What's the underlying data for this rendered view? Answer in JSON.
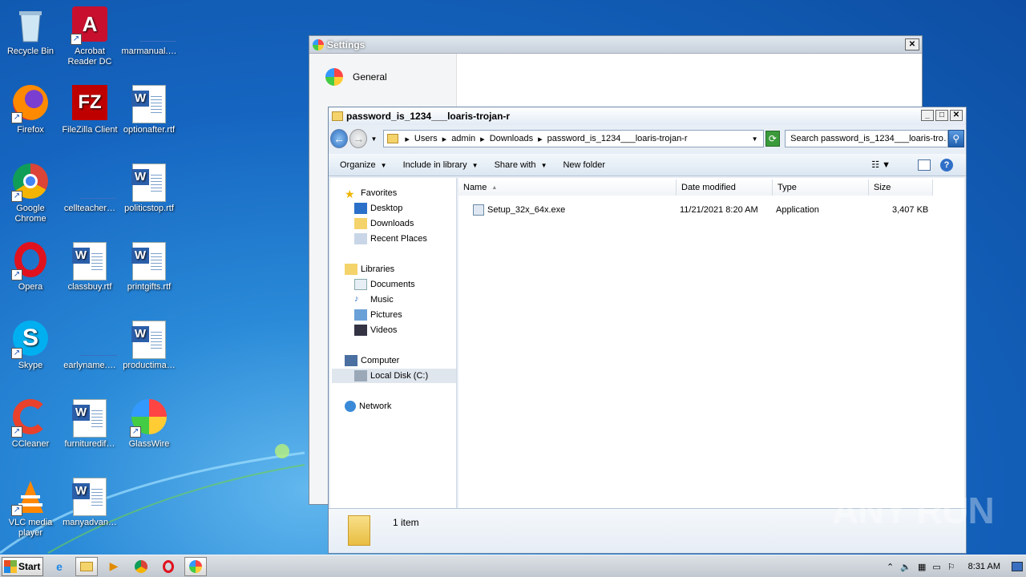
{
  "desktop": {
    "icons": [
      {
        "label": "Recycle Bin",
        "icon": "recycle-bin-icon"
      },
      {
        "label": "Acrobat Reader DC",
        "icon": "acrobat-icon"
      },
      {
        "label": "marmanual.…",
        "icon": "word-doc-icon"
      },
      {
        "label": "Firefox",
        "icon": "firefox-icon"
      },
      {
        "label": "FileZilla Client",
        "icon": "filezilla-icon"
      },
      {
        "label": "optionafter.rtf",
        "icon": "word-doc-icon"
      },
      {
        "label": "Google Chrome",
        "icon": "chrome-icon"
      },
      {
        "label": "cellteacher…",
        "icon": "word-doc-icon"
      },
      {
        "label": "politicstop.rtf",
        "icon": "word-doc-icon"
      },
      {
        "label": "Opera",
        "icon": "opera-icon"
      },
      {
        "label": "classbuy.rtf",
        "icon": "word-doc-icon"
      },
      {
        "label": "printgifts.rtf",
        "icon": "word-doc-icon"
      },
      {
        "label": "Skype",
        "icon": "skype-icon"
      },
      {
        "label": "earlyname.…",
        "icon": "word-doc-icon"
      },
      {
        "label": "productima…",
        "icon": "word-doc-icon"
      },
      {
        "label": "CCleaner",
        "icon": "ccleaner-icon"
      },
      {
        "label": "furnituredif…",
        "icon": "word-doc-icon"
      },
      {
        "label": "GlassWire",
        "icon": "glasswire-icon"
      },
      {
        "label": "VLC media player",
        "icon": "vlc-icon"
      },
      {
        "label": "manyadvan…",
        "icon": "word-doc-icon"
      }
    ]
  },
  "settings": {
    "title": "Settings",
    "close": "✕",
    "general": "General"
  },
  "explorer": {
    "title": "password_is_1234___loaris-trojan-r",
    "breadcrumb": [
      "Users",
      "admin",
      "Downloads",
      "password_is_1234___loaris-trojan-r"
    ],
    "search_placeholder": "Search password_is_1234___loaris-tro…",
    "commands": [
      "Organize",
      "Include in library",
      "Share with",
      "New folder"
    ],
    "nav": {
      "favorites": "Favorites",
      "desktop": "Desktop",
      "downloads": "Downloads",
      "recent": "Recent Places",
      "libraries": "Libraries",
      "documents": "Documents",
      "music": "Music",
      "pictures": "Pictures",
      "videos": "Videos",
      "computer": "Computer",
      "local_disk": "Local Disk (C:)",
      "network": "Network"
    },
    "columns": [
      "Name",
      "Date modified",
      "Type",
      "Size"
    ],
    "files": [
      {
        "name": "Setup_32x_64x.exe",
        "date": "11/21/2021 8:20 AM",
        "type": "Application",
        "size": "3,407 KB"
      }
    ],
    "status": "1 item"
  },
  "taskbar": {
    "start": "Start",
    "clock": "8:31 AM"
  },
  "watermark": "ANY RUN"
}
